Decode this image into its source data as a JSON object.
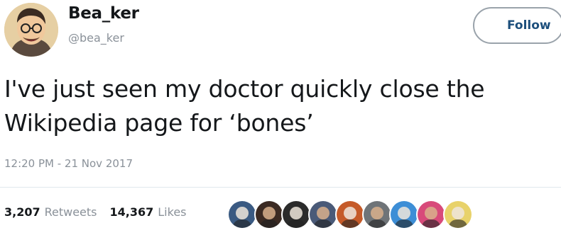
{
  "user": {
    "display_name": "Bea_ker",
    "handle": "@bea_ker",
    "avatar_icon": "cartoon-man-avatar-icon"
  },
  "follow_button": {
    "label": "Follow"
  },
  "tweet": {
    "line1": "I've just seen my doctor quickly close the",
    "line2": "Wikipedia page for ‘bones’",
    "timestamp": "12:20 PM - 21 Nov 2017"
  },
  "stats": {
    "retweets_count": "3,207",
    "retweets_label": "Retweets",
    "likes_count": "14,367",
    "likes_label": "Likes"
  },
  "likers": [
    {
      "icon": "liker-avatar-icon",
      "color": "#3a5a82"
    },
    {
      "icon": "liker-avatar-icon",
      "color": "#3b2a22"
    },
    {
      "icon": "liker-avatar-icon",
      "color": "#2b2b2b"
    },
    {
      "icon": "liker-avatar-icon",
      "color": "#4a5a78"
    },
    {
      "icon": "liker-avatar-icon",
      "color": "#c55a28"
    },
    {
      "icon": "liker-avatar-icon",
      "color": "#6f7478"
    },
    {
      "icon": "liker-avatar-icon",
      "color": "#3d8ed6"
    },
    {
      "icon": "liker-avatar-icon",
      "color": "#d84a7a"
    },
    {
      "icon": "liker-avatar-icon",
      "color": "#e8d26a"
    }
  ]
}
